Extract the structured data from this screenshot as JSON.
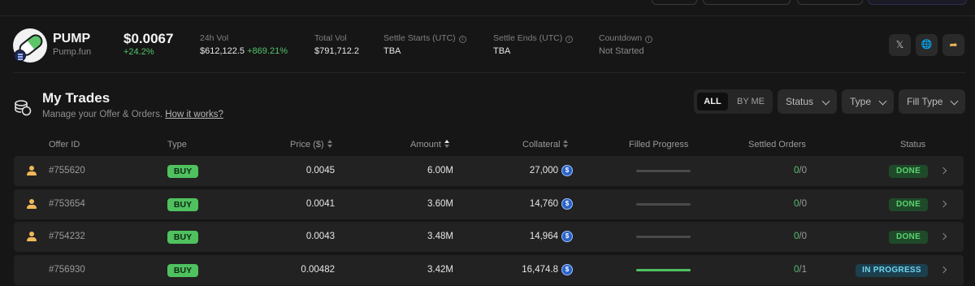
{
  "token": {
    "symbol": "PUMP",
    "name": "Pump.fun",
    "price": "$0.0067",
    "change": "+24.2%"
  },
  "stats": {
    "vol24h_label": "24h Vol",
    "vol24h_value": "$612,122.5",
    "vol24h_change": "+869.21%",
    "total_vol_label": "Total Vol",
    "total_vol_value": "$791,712.2",
    "settle_starts_label": "Settle Starts (UTC)",
    "settle_starts_value": "TBA",
    "settle_ends_label": "Settle Ends (UTC)",
    "settle_ends_value": "TBA",
    "countdown_label": "Countdown",
    "countdown_value": "Not Started",
    "info_glyph": "i"
  },
  "social": {
    "x_glyph": "𝕏",
    "web_glyph": "🌐",
    "share_glyph": "➦",
    "share_color": "#f0b85a"
  },
  "section": {
    "title": "My Trades",
    "subtitle": "Manage your Offer & Orders.",
    "link": "How it works?"
  },
  "filters": {
    "all": "ALL",
    "by_me": "BY ME",
    "status": "Status",
    "type": "Type",
    "fill_type": "Fill Type"
  },
  "columns": {
    "offer_id": "Offer ID",
    "type": "Type",
    "price": "Price ($)",
    "amount": "Amount",
    "collateral": "Collateral",
    "filled_progress": "Filled Progress",
    "settled_orders": "Settled Orders",
    "status": "Status"
  },
  "rows": [
    {
      "offer_id": "#755620",
      "type": "BUY",
      "price": "0.0045",
      "amount": "6.00M",
      "collateral": "27,000",
      "coin": "$",
      "progress": 0,
      "settled": "0",
      "settled_total": "/0",
      "status": "DONE",
      "by_me": true
    },
    {
      "offer_id": "#753654",
      "type": "BUY",
      "price": "0.0041",
      "amount": "3.60M",
      "collateral": "14,760",
      "coin": "$",
      "progress": 0,
      "settled": "0",
      "settled_total": "/0",
      "status": "DONE",
      "by_me": true
    },
    {
      "offer_id": "#754232",
      "type": "BUY",
      "price": "0.0043",
      "amount": "3.48M",
      "collateral": "14,964",
      "coin": "$",
      "progress": 0,
      "settled": "0",
      "settled_total": "/0",
      "status": "DONE",
      "by_me": true
    },
    {
      "offer_id": "#756930",
      "type": "BUY",
      "price": "0.00482",
      "amount": "3.42M",
      "collateral": "16,474.8",
      "coin": "$",
      "progress": 1,
      "settled": "0",
      "settled_total": "/1",
      "status": "IN PROGRESS",
      "by_me": false
    }
  ],
  "colors": {
    "background": "#161616",
    "row": "#222222",
    "buy": "#4fc15f",
    "done": "#5ad36d",
    "in_progress": "#6fd6ef",
    "user_icon": "#f0b85a"
  }
}
